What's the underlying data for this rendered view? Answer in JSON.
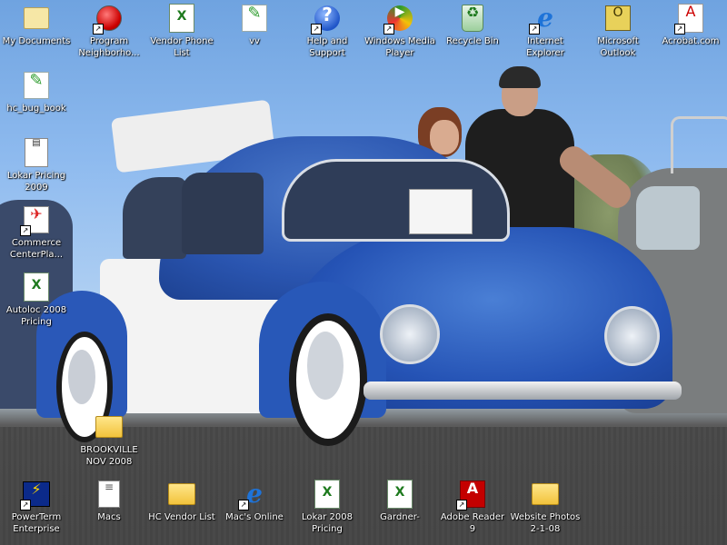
{
  "desktop": {
    "icons": [
      {
        "label": "My Documents",
        "glyph": "📁",
        "shortcut": ""
      },
      {
        "label": "Program\nNeighborho...",
        "glyph": "",
        "shortcut": "↗"
      },
      {
        "label": "Vendor Phone\nList",
        "glyph": "X",
        "shortcut": ""
      },
      {
        "label": "vv",
        "glyph": "✎",
        "shortcut": ""
      },
      {
        "label": "Help and\nSupport",
        "glyph": "?",
        "shortcut": "↗"
      },
      {
        "label": "Windows Media\nPlayer",
        "glyph": "▶",
        "shortcut": "↗"
      },
      {
        "label": "Recycle Bin",
        "glyph": "♻",
        "shortcut": ""
      },
      {
        "label": "Internet\nExplorer",
        "glyph": "e",
        "shortcut": "↗"
      },
      {
        "label": "Microsoft\nOutlook",
        "glyph": "O",
        "shortcut": ""
      },
      {
        "label": "Acrobat.com",
        "glyph": "A",
        "shortcut": "↗"
      },
      {
        "label": "hc_bug_book",
        "glyph": "✎",
        "shortcut": ""
      },
      {
        "label": "Lokar Pricing\n2009",
        "glyph": "▤",
        "shortcut": ""
      },
      {
        "label": "Commerce\nCenterPla...",
        "glyph": "✈",
        "shortcut": "↗"
      },
      {
        "label": "Autoloc 2008\nPricing",
        "glyph": "X",
        "shortcut": ""
      },
      {
        "label": "BROOKVILLE\nNOV 2008",
        "glyph": "",
        "shortcut": ""
      },
      {
        "label": "PowerTerm\nEnterprise",
        "glyph": "⚡",
        "shortcut": "↗"
      },
      {
        "label": "Macs",
        "glyph": "≡",
        "shortcut": ""
      },
      {
        "label": "HC Vendor List",
        "glyph": "",
        "shortcut": ""
      },
      {
        "label": "Mac's Online",
        "glyph": "e",
        "shortcut": "↗"
      },
      {
        "label": "Lokar 2008\nPricing",
        "glyph": "X",
        "shortcut": ""
      },
      {
        "label": "Gardner-",
        "glyph": "X",
        "shortcut": ""
      },
      {
        "label": "Adobe Reader\n9",
        "glyph": "A",
        "shortcut": "↗"
      },
      {
        "label": "Website Photos\n2-1-08",
        "glyph": "",
        "shortcut": ""
      }
    ]
  }
}
